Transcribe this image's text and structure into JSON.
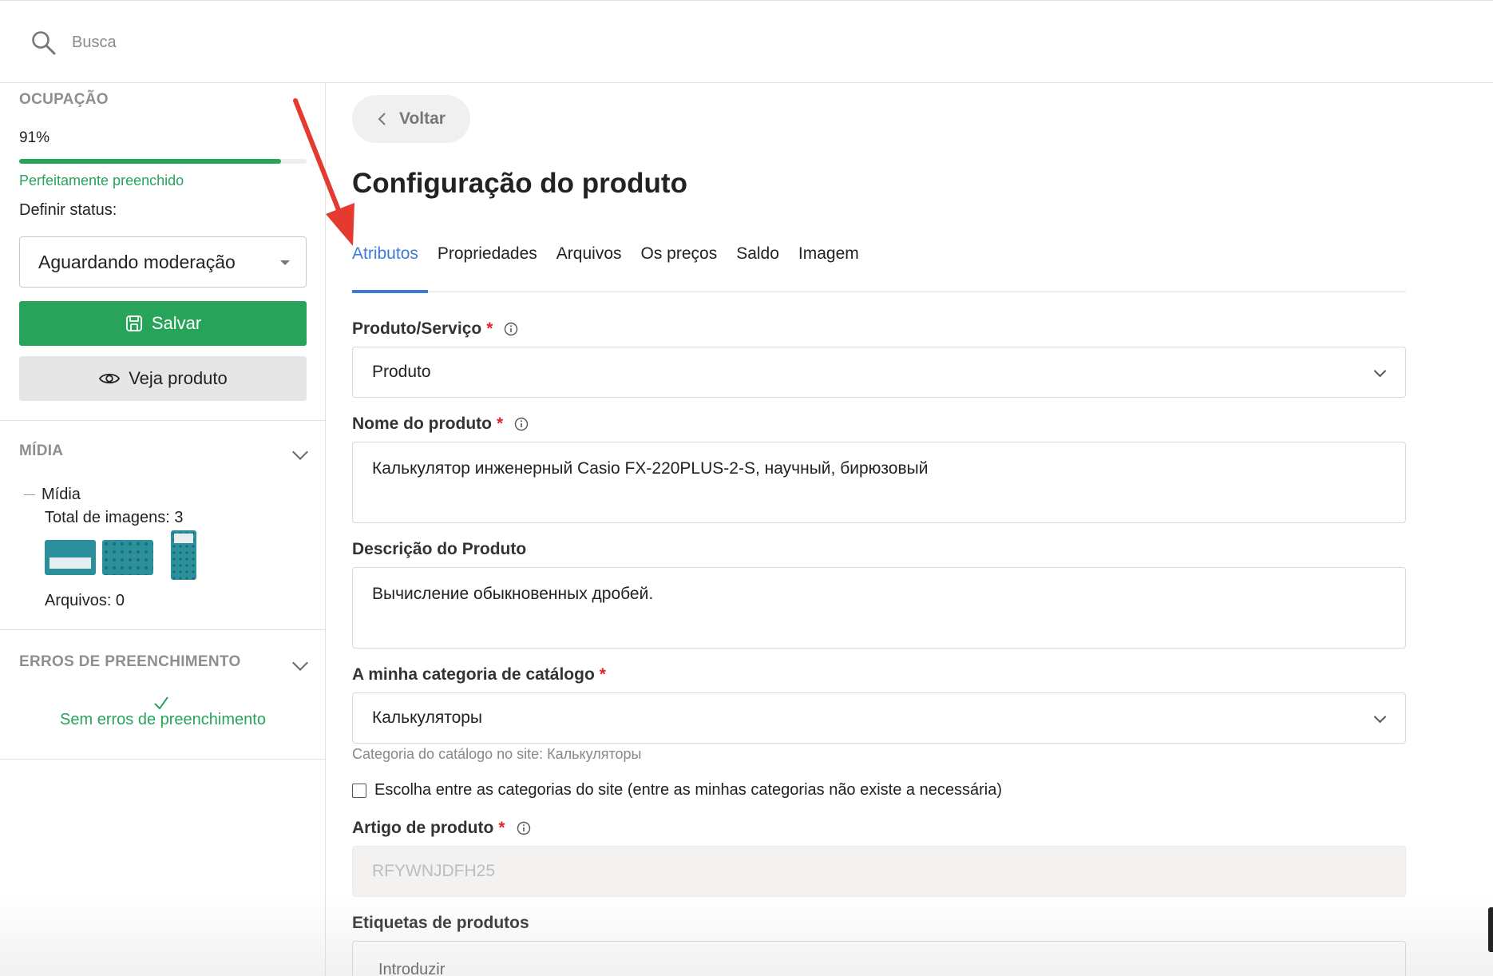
{
  "search": {
    "placeholder": "Busca"
  },
  "sidebar": {
    "occupancy": {
      "title": "OCUPAÇÃO",
      "percent_label": "91%",
      "progress": 0.91,
      "status": "Perfeitamente preenchido"
    },
    "define_status_label": "Definir status:",
    "status_value": "Aguardando moderação",
    "save_label": "Salvar",
    "view_label": "Veja produto",
    "media": {
      "title": "MÍDIA",
      "tree_label": "Mídia",
      "total_images": "Total de imagens: 3",
      "files": "Arquivos: 0"
    },
    "errors": {
      "title": "ERROS DE PREENCHIMENTO",
      "status": "Sem erros de preenchimento"
    }
  },
  "main": {
    "back_label": "Voltar",
    "title": "Configuração do produto",
    "tabs": [
      {
        "label": "Atributos",
        "active": true
      },
      {
        "label": "Propriedades",
        "active": false
      },
      {
        "label": "Arquivos",
        "active": false
      },
      {
        "label": "Os preços",
        "active": false
      },
      {
        "label": "Saldo",
        "active": false
      },
      {
        "label": "Imagem",
        "active": false
      }
    ],
    "fields": {
      "product_type": {
        "label": "Produto/Serviço",
        "value": "Produto"
      },
      "product_name": {
        "label": "Nome do produto",
        "value": "Калькулятор инженерный Casio FX-220PLUS-2-S, научный, бирюзовый"
      },
      "description": {
        "label": "Descrição do Produto",
        "value": "Вычисление обыкновенных дробей."
      },
      "category": {
        "label": "A minha categoria de catálogo",
        "value": "Калькуляторы",
        "hint": "Categoria do catálogo no site: Калькуляторы"
      },
      "site_category_checkbox": "Escolha entre as categorias do site (entre as minhas categorias não existe a necessária)",
      "article": {
        "label": "Artigo de produto",
        "value": "RFYWNJDFH25"
      },
      "tags": {
        "label": "Etiquetas de produtos",
        "placeholder": "Introduzir"
      }
    },
    "required_mark": "*"
  },
  "colors": {
    "accent_green": "#27a35a",
    "tab_active_blue": "#3d7bd4",
    "required_red": "#e0262b",
    "annotation_arrow": "#e53a30"
  }
}
